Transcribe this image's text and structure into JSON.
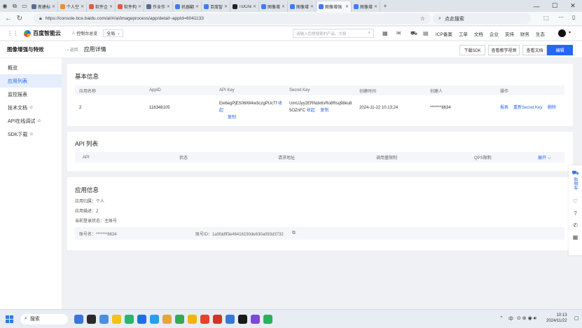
{
  "browser": {
    "tabs": [
      {
        "label": "新建标签页",
        "color": "#5a6b8c"
      },
      {
        "label": "个人空间",
        "color": "#f08c2c"
      },
      {
        "label": "软件企业",
        "color": "#e25a3f"
      },
      {
        "label": "软件构造",
        "color": "#e25a3f"
      },
      {
        "label": "作业作答",
        "color": "#5a6b8c"
      },
      {
        "label": "机器翻译",
        "color": "#3e7cf6"
      },
      {
        "label": "百度智能",
        "color": "#3e7cf6"
      },
      {
        "label": "TDChat_",
        "color": "#222222"
      },
      {
        "label": "图像增强",
        "color": "#3e7cf6"
      },
      {
        "label": "图像增强",
        "color": "#3e7cf6"
      },
      {
        "label": "图像增强",
        "color": "#3e7cf6"
      },
      {
        "label": "图像增强",
        "color": "#3e7cf6"
      }
    ],
    "active_tab": 10,
    "url": "https://console.bce.baidu.com/ai/#/ai/imageprocess/app/detail~appId=6041133",
    "search_placeholder": "点此搜索"
  },
  "header": {
    "logo": "百度智能云",
    "console": "控制台总览",
    "region": "全局",
    "search_placeholder": "请输入您想搜索的产品、文档",
    "menu": [
      "ICP备案",
      "工单",
      "文档",
      "企业",
      "支持",
      "财务",
      "生态"
    ]
  },
  "sidebar": {
    "title": "图像增强与特效",
    "items": [
      {
        "label": "概览",
        "active": false,
        "ext": false
      },
      {
        "label": "应用列表",
        "active": true,
        "ext": false
      },
      {
        "label": "监控报表",
        "active": false,
        "ext": false
      },
      {
        "label": "技术文档",
        "active": false,
        "ext": true
      },
      {
        "label": "API在线调试",
        "active": false,
        "ext": true
      },
      {
        "label": "SDK下载",
        "active": false,
        "ext": true
      }
    ]
  },
  "page": {
    "back": "返回",
    "title": "应用详情",
    "buttons": {
      "sdk": "下载SDK",
      "video": "查看教学视频",
      "docs": "查看文档",
      "edit": "编辑"
    }
  },
  "basic": {
    "title": "基本信息",
    "headers": [
      "应用名称",
      "AppID",
      "API Key",
      "Secret Key",
      "创建时间",
      "创建人",
      "操作"
    ],
    "row": {
      "name": "2",
      "appid": "116348105",
      "api_key": "Ew6egPjES06lW4w3czgPUcTf",
      "api_key_hide": "收起",
      "api_key_copy": "复制",
      "secret_line1": "UmUJyy2ERNdx6vRo8Rsq98ku8",
      "secret_line2": "5OZnFC",
      "secret_hide": "收起",
      "secret_copy": "复制",
      "created": "2024-11-22 10:13:24",
      "creator": "*******8634",
      "ops": [
        "报表",
        "重新Secret Key",
        "删除"
      ]
    }
  },
  "api_list": {
    "title": "API 列表",
    "headers": [
      "API",
      "状态",
      "请求地址",
      "调用量限制",
      "QPS限制"
    ],
    "expand": "展开"
  },
  "app_info": {
    "title": "应用信息",
    "belong": "应用归属：个人",
    "desc": "应用描述：2",
    "login_type": "当前登录状态：主账号",
    "account_name": "账号名：*******8634",
    "account_id": "账号ID：1a0fddff3e46416190de630a093d3732"
  },
  "float": {
    "cart": "购物车"
  },
  "taskbar": {
    "search": "搜索",
    "time": "10:13",
    "date": "2024/11/22",
    "ime": "中"
  }
}
